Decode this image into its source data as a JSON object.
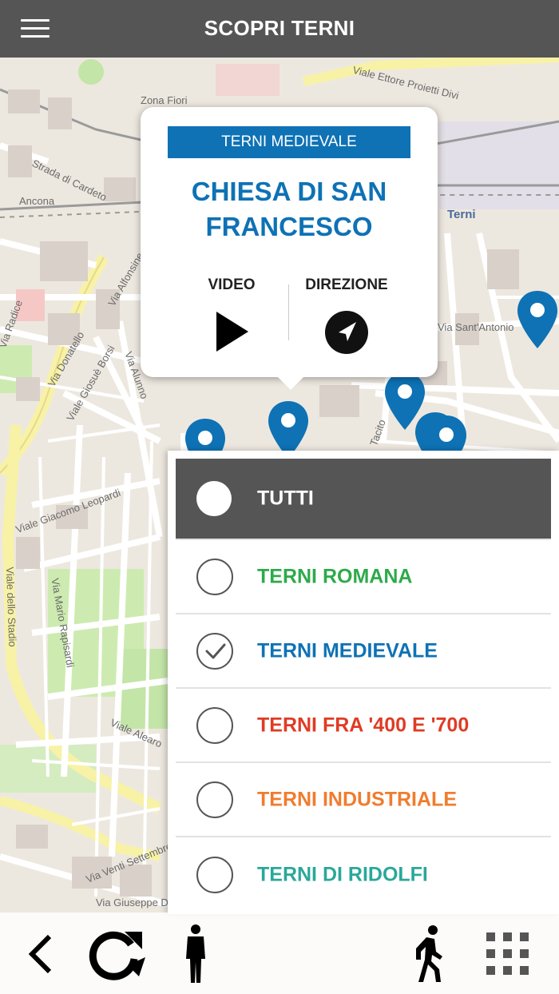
{
  "header": {
    "title": "SCOPRI TERNI"
  },
  "map": {
    "street_labels": [
      "Viale Ettore Proietti Divi",
      "Zona Fiori",
      "Strada di Cardeto",
      "Ancona",
      "Terni",
      "Via Sant'Antonio",
      "Via Alfonsine",
      "Via Donatello",
      "Viale Giosuè Borsi",
      "Via Alunno",
      "Viale Giacomo Leopardi",
      "Viale dello Stadio",
      "Via Mario Rapisardi",
      "Viale Alearo",
      "Via Venti Settembre",
      "Via Giuseppe Di Vittorio",
      "Via Radice",
      "Tacito"
    ]
  },
  "popup": {
    "category": "TERNI MEDIEVALE",
    "title": "CHIESA DI SAN FRANCESCO",
    "actions": {
      "video": "VIDEO",
      "direction": "DIREZIONE"
    },
    "accent_color": "#0e72b5"
  },
  "filters": {
    "all": {
      "label": "TUTTI",
      "selected": true
    },
    "items": [
      {
        "label": "TERNI ROMANA",
        "color": "#2eaa4a",
        "checked": false
      },
      {
        "label": "TERNI MEDIEVALE",
        "color": "#0e72b5",
        "checked": true
      },
      {
        "label": "TERNI FRA '400 E '700",
        "color": "#e03b24",
        "checked": false
      },
      {
        "label": "TERNI INDUSTRIALE",
        "color": "#f07c2e",
        "checked": false
      },
      {
        "label": "TERNI DI RIDOLFI",
        "color": "#2aa89a",
        "checked": false
      }
    ]
  },
  "toolbar": {
    "icons": [
      "back-icon",
      "refresh-icon",
      "person-standing-icon",
      "walking-icon",
      "grid-menu-icon"
    ]
  },
  "colors": {
    "header_bg": "#555555",
    "pin": "#0e72b5"
  }
}
